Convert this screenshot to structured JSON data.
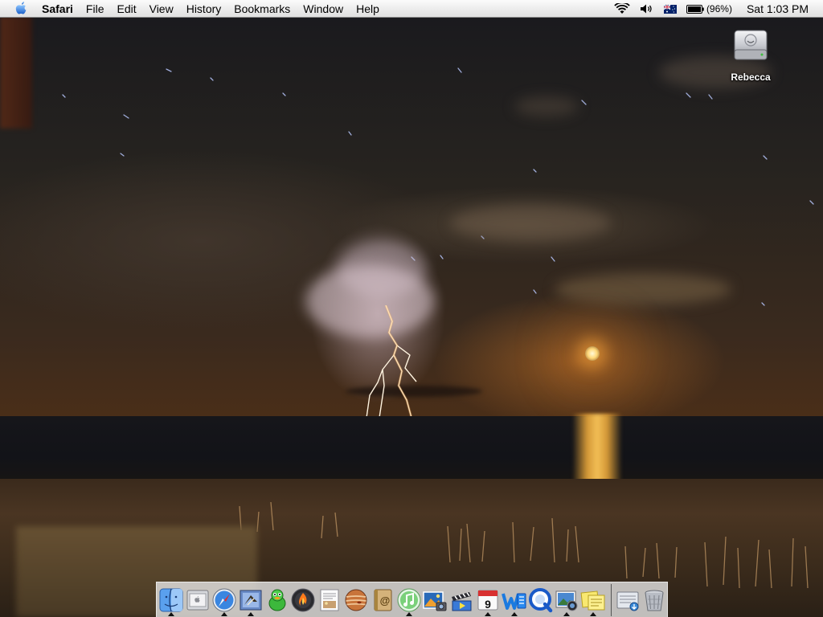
{
  "menubar": {
    "apple_icon": "apple-logo-icon",
    "app_name": "Safari",
    "menus": [
      "File",
      "Edit",
      "View",
      "History",
      "Bookmarks",
      "Window",
      "Help"
    ],
    "status": {
      "wifi_icon": "wifi-icon",
      "volume_icon": "volume-icon",
      "input_flag_icon": "australian-flag-icon",
      "battery_icon": "battery-icon",
      "battery_text": "(96%)",
      "clock": "Sat 1:03 PM"
    }
  },
  "desktop": {
    "icons": [
      {
        "label": "Rebecca",
        "icon": "hard-drive-icon"
      }
    ]
  },
  "dock": {
    "apps": [
      {
        "icon": "finder-icon",
        "running": true
      },
      {
        "icon": "system-preferences-icon",
        "running": false
      },
      {
        "icon": "safari-icon",
        "running": true
      },
      {
        "icon": "mail-icon",
        "running": true
      },
      {
        "icon": "adium-duck-icon",
        "running": false
      },
      {
        "icon": "firefox-burn-icon",
        "running": false
      },
      {
        "icon": "preview-icon",
        "running": false
      },
      {
        "icon": "jupiter-icon",
        "running": false
      },
      {
        "icon": "address-book-icon",
        "running": false
      },
      {
        "icon": "itunes-icon",
        "running": true
      },
      {
        "icon": "iphoto-icon",
        "running": false
      },
      {
        "icon": "imovie-icon",
        "running": false
      },
      {
        "icon": "ical-icon",
        "running": true,
        "date": "9"
      },
      {
        "icon": "word-icon",
        "running": true
      },
      {
        "icon": "quicktime-icon",
        "running": false
      },
      {
        "icon": "photo-browser-icon",
        "running": true
      },
      {
        "icon": "stickies-icon",
        "running": true
      }
    ],
    "others": [
      {
        "icon": "downloads-folder-icon",
        "running": false
      },
      {
        "icon": "trash-icon",
        "running": false
      }
    ]
  },
  "colors": {
    "menubar_bg": "#ececec",
    "dock_bg": "#ebebeb",
    "sky": "#26231f",
    "moon": "#ffd878"
  }
}
